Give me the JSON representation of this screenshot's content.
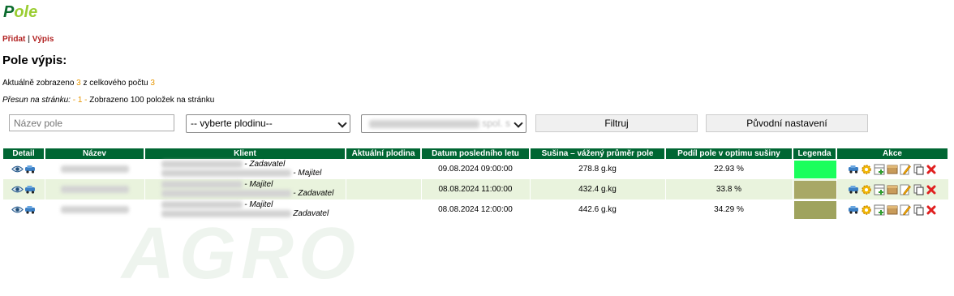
{
  "logo": {
    "p": "P",
    "rest": "ole"
  },
  "nav": {
    "add": "Přidat",
    "sep": " | ",
    "list": "Výpis"
  },
  "page_title": "Pole výpis:",
  "info": {
    "prefix": "Aktuálně zobrazeno ",
    "shown": "3",
    "middle": " z celkového počtu ",
    "total": "3",
    "page_label": "Přesun na stránku:",
    "page_sep1": " - ",
    "page_num": "1",
    "page_sep2": " - ",
    "page_suffix": "Zobrazeno 100 položek na stránku"
  },
  "filters": {
    "name_placeholder": "Název pole",
    "crop_select": "-- vyberte plodinu--",
    "company_select": "spol. s",
    "filter_button": "Filtruj",
    "reset_button": "Původní nastavení"
  },
  "table": {
    "headers": [
      "Detail",
      "Název",
      "Klient",
      "Aktuální plodina",
      "Datum posledního letu",
      "Sušina – vážený průměr pole",
      "Podíl pole v optimu sušiny",
      "Legenda",
      "Akce"
    ],
    "rows": [
      {
        "client_role1": "- Zadavatel",
        "client_role2": "- Majitel",
        "crop": "",
        "date": "09.08.2024 09:00:00",
        "dry": "278.8 g.kg",
        "share": "22.93 %",
        "legend_color": "#1aff5c"
      },
      {
        "client_role1": "- Majitel",
        "client_role2": "- Zadavatel",
        "crop": "",
        "date": "08.08.2024 11:00:00",
        "dry": "432.4 g.kg",
        "share": "33.8 %",
        "legend_color": "#a8a866"
      },
      {
        "client_role1": "- Majitel",
        "client_role2": "Zadavatel",
        "crop": "",
        "date": "08.08.2024 12:00:00",
        "dry": "442.6 g.kg",
        "share": "34.29 %",
        "legend_color": "#9fa35e"
      }
    ]
  },
  "colors": {
    "header_bg": "#006633",
    "alt_row": "#e9f3dd",
    "number_accent": "#e69500",
    "link": "#b22222"
  }
}
